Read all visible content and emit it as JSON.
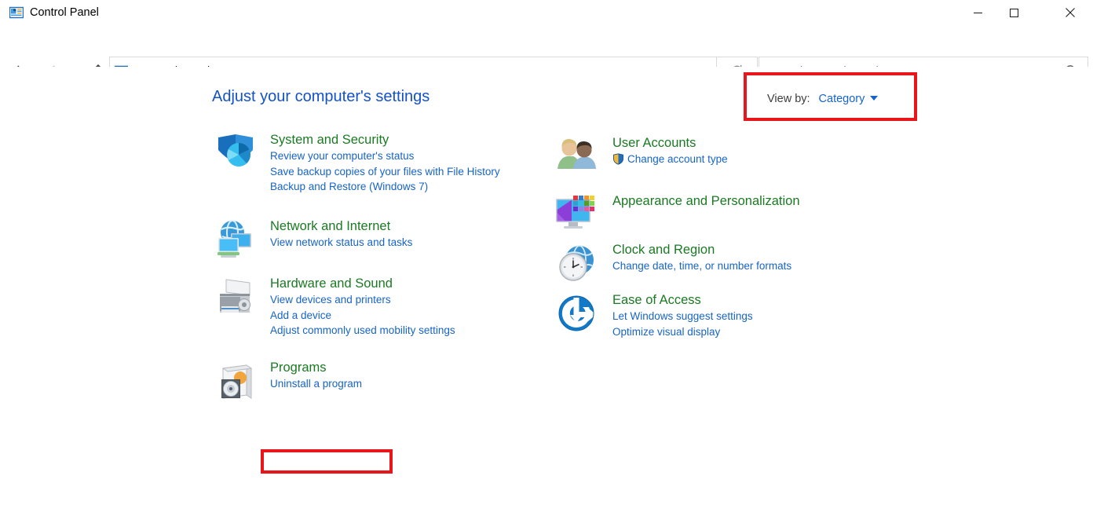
{
  "window": {
    "title": "Control Panel",
    "icon": "control-panel-icon",
    "controls": {
      "minimize": "Minimize",
      "maximize": "Maximize",
      "close": "Close"
    }
  },
  "navigation": {
    "back": "Back",
    "forward": "Forward",
    "recent": "Recent locations",
    "up": "Up one level",
    "address": {
      "icon": "control-panel-icon",
      "separator": "›",
      "path": "Control Panel",
      "dropdown": "Previous locations"
    },
    "refresh": "Refresh Control Panel"
  },
  "search": {
    "placeholder": "Search Control Panel",
    "value": "",
    "icon": "search-icon"
  },
  "main": {
    "heading": "Adjust your computer's settings",
    "view_by": {
      "label": "View by:",
      "value": "Category",
      "caret": "chevron-down-icon",
      "highlighted": true
    },
    "highlight_color": "#e8161a",
    "heading_color": "#1452c8",
    "category_title_color": "#1a7a22",
    "link_color": "#1664c8",
    "left_column": [
      {
        "icon": "shield-security-icon",
        "title": "System and Security",
        "links": [
          {
            "text": "Review your computer's status"
          },
          {
            "text": "Save backup copies of your files with File History"
          },
          {
            "text": "Backup and Restore (Windows 7)"
          }
        ]
      },
      {
        "icon": "network-globe-monitor-icon",
        "title": "Network and Internet",
        "links": [
          {
            "text": "View network status and tasks"
          }
        ]
      },
      {
        "icon": "printer-hardware-icon",
        "title": "Hardware and Sound",
        "links": [
          {
            "text": "View devices and printers"
          },
          {
            "text": "Add a device"
          },
          {
            "text": "Adjust commonly used mobility settings"
          }
        ]
      },
      {
        "icon": "programs-box-cd-icon",
        "title": "Programs",
        "links": [
          {
            "text": "Uninstall a program",
            "highlighted": true
          }
        ]
      }
    ],
    "right_column": [
      {
        "icon": "user-accounts-people-icon",
        "title": "User Accounts",
        "links": [
          {
            "text": "Change account type",
            "shield": true
          }
        ]
      },
      {
        "icon": "appearance-monitor-colors-icon",
        "title": "Appearance and Personalization",
        "links": []
      },
      {
        "icon": "clock-globe-icon",
        "title": "Clock and Region",
        "links": [
          {
            "text": "Change date, time, or number formats"
          }
        ]
      },
      {
        "icon": "ease-of-access-icon",
        "title": "Ease of Access",
        "links": [
          {
            "text": "Let Windows suggest settings"
          },
          {
            "text": "Optimize visual display"
          }
        ]
      }
    ]
  }
}
